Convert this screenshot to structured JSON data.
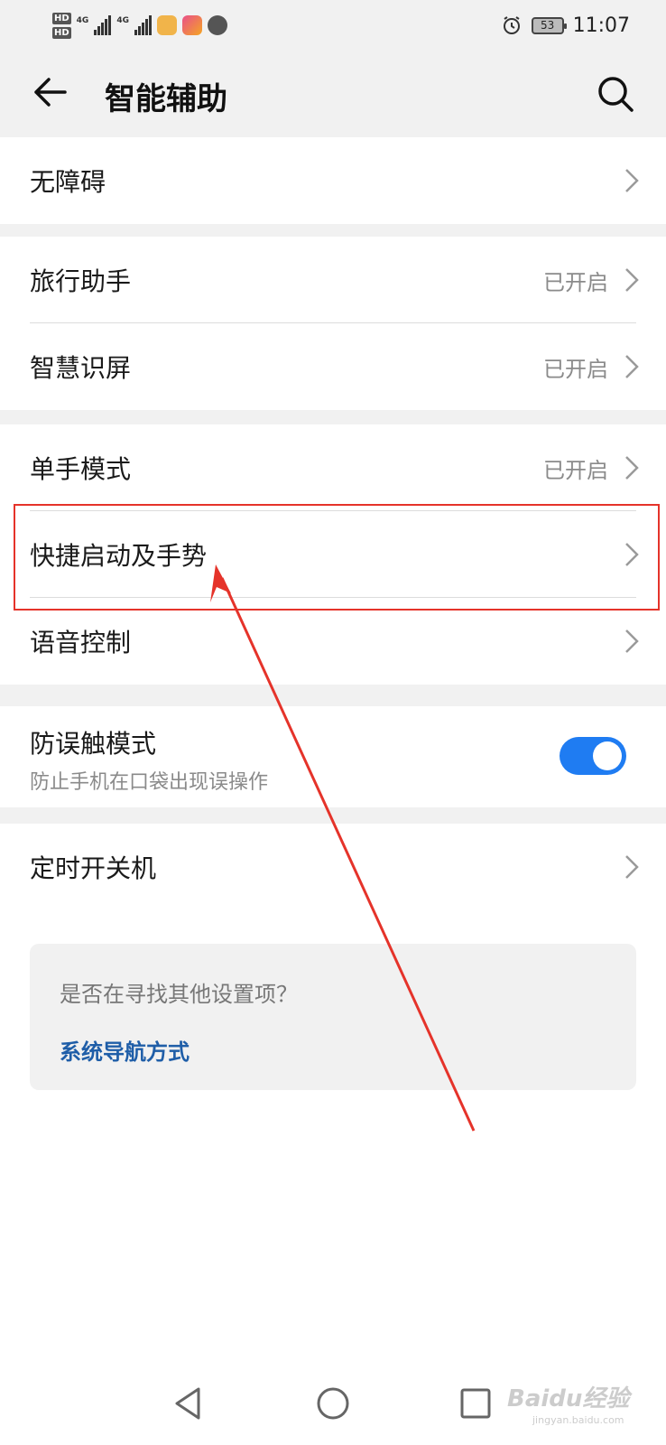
{
  "status_bar": {
    "time": "11:07",
    "battery": "53",
    "hd1": "HD",
    "hd2": "HD",
    "net1": "4G",
    "net2": "4G"
  },
  "app_bar": {
    "title": "智能辅助",
    "back_icon": "arrow-left-icon",
    "search_icon": "search-icon"
  },
  "sections": {
    "s1": {
      "items": [
        {
          "label": "无障碍"
        }
      ]
    },
    "s2": {
      "items": [
        {
          "label": "旅行助手",
          "status": "已开启"
        },
        {
          "label": "智慧识屏",
          "status": "已开启"
        }
      ]
    },
    "s3": {
      "items": [
        {
          "label": "单手模式",
          "status": "已开启"
        },
        {
          "label": "快捷启动及手势"
        },
        {
          "label": "语音控制"
        }
      ]
    },
    "s4": {
      "label": "防误触模式",
      "sub": "防止手机在口袋出现误操作",
      "toggle_on": true
    },
    "s5": {
      "items": [
        {
          "label": "定时开关机"
        }
      ]
    }
  },
  "hint": {
    "question": "是否在寻找其他设置项？",
    "link": "系统导航方式"
  },
  "watermark": {
    "main": "Baidu经验",
    "sub": "jingyan.baidu.com"
  },
  "colors": {
    "accent": "#1f7cf2",
    "link": "#1f5ea8",
    "annotation": "#e5332a"
  }
}
